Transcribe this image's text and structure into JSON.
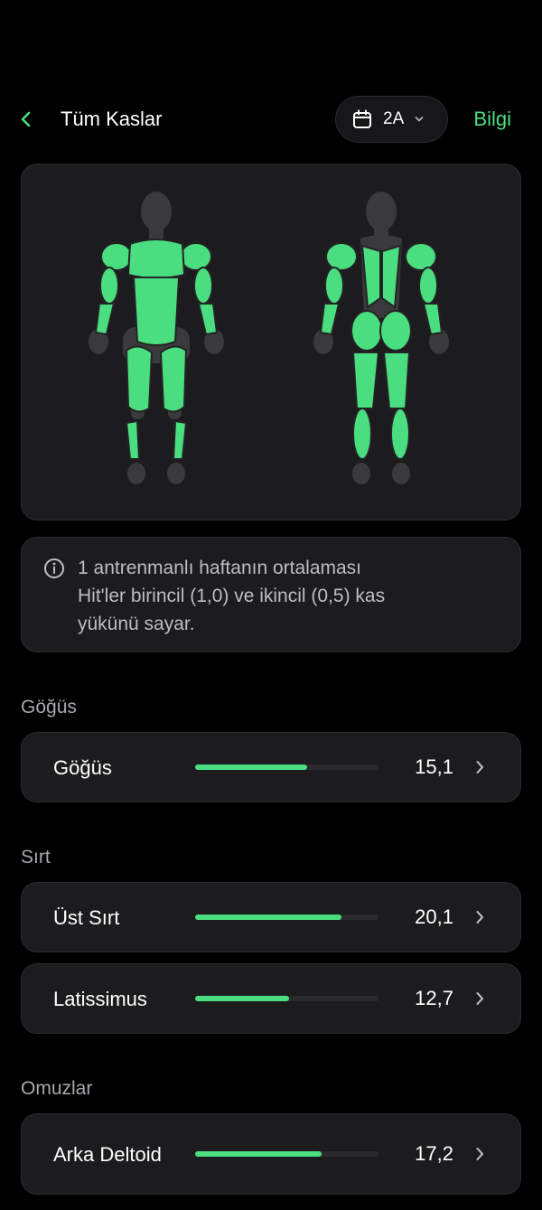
{
  "header": {
    "title": "Tüm Kaslar",
    "period": "2A",
    "info_label": "Bilgi"
  },
  "note": {
    "lines": [
      "1 antrenmanlı haftanın ortalaması",
      "Hit'ler birincil (1,0) ve ikincil (0,5) kas",
      "yükünü sayar."
    ]
  },
  "sections": [
    {
      "title": "Göğüs",
      "rows": [
        {
          "name": "Göğüs",
          "value": "15,1",
          "level": 0.61
        }
      ]
    },
    {
      "title": "Sırt",
      "rows": [
        {
          "name": "Üst Sırt",
          "value": "20,1",
          "level": 0.8
        },
        {
          "name": "Latissimus",
          "value": "12,7",
          "level": 0.51
        }
      ]
    },
    {
      "title": "Omuzlar",
      "rows": [
        {
          "name": "Arka Deltoid",
          "value": "17,2",
          "level": 0.69
        }
      ]
    }
  ],
  "colors": {
    "accent": "#4ade80",
    "highlight_muscle": "#4ade80",
    "inactive_muscle": "#3a3a3c",
    "card": "#1c1c1e"
  }
}
